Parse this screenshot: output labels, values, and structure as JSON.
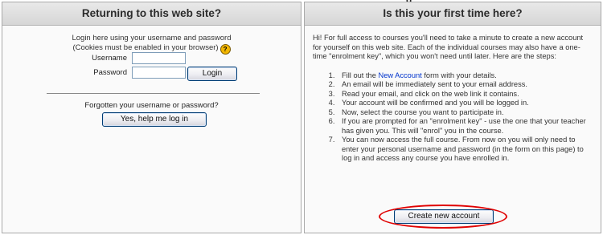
{
  "returning": {
    "header": "Returning to this web site?",
    "intro_line1": "Login here using your username and password",
    "intro_line2": "(Cookies must be enabled in your browser)",
    "help_glyph": "?",
    "username_label": "Username",
    "username_value": "",
    "password_label": "Password",
    "password_value": "",
    "login_button": "Login",
    "forgot_text": "Forgotten your username or password?",
    "help_button": "Yes, help me log in"
  },
  "first_time": {
    "header": "Is this your first time here?",
    "intro": "Hi! For full access to courses you'll need to take a minute to create a new account for yourself on this web site. Each of the individual courses may also have a one-time \"enrolment key\", which you won't need until later. Here are the steps:",
    "step1_before": "Fill out the ",
    "step1_link": "New Account",
    "step1_after": " form with your details.",
    "step2": "An email will be immediately sent to your email address.",
    "step3": "Read your email, and click on the web link it contains.",
    "step4": "Your account will be confirmed and you will be logged in.",
    "step5": "Now, select the course you want to participate in.",
    "step6": "If you are prompted for an \"enrolment key\" - use the one that your teacher has given you. This will \"enrol\" you in the course.",
    "step7": "You can now access the full course. From now on you will only need to enter your personal username and password (in the form on this page) to log in and access any course you have enrolled in.",
    "create_button": "Create new account"
  },
  "clipped_top_text": "g",
  "colors": {
    "highlight_oval": "#e00000",
    "link": "#0033cc",
    "panel_border": "#a9a9a9"
  }
}
